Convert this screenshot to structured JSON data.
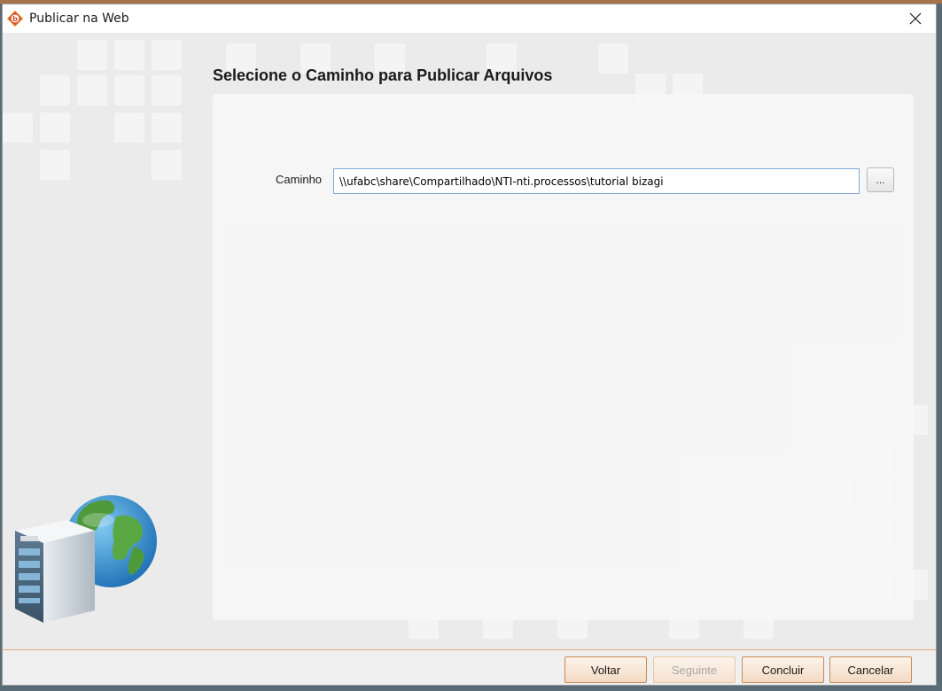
{
  "window": {
    "title": "Publicar na Web",
    "app_icon": "bizagi-logo-icon",
    "close_icon": "close-icon"
  },
  "page": {
    "heading": "Selecione o Caminho para Publicar Arquivos"
  },
  "form": {
    "path_label": "Caminho",
    "path_value": "\\\\ufabc\\share\\Compartilhado\\NTI-nti.processos\\tutorial bizagi",
    "browse_label": "..."
  },
  "footer": {
    "buttons": [
      {
        "label": "Voltar",
        "enabled": true
      },
      {
        "label": "Seguinte",
        "enabled": false
      },
      {
        "label": "Concluir",
        "enabled": true
      },
      {
        "label": "Cancelar",
        "enabled": true
      }
    ]
  },
  "illustration": {
    "icon": "server-globe-icon"
  },
  "colors": {
    "accent": "#e8a66e",
    "button_border": "#c98a55",
    "input_focus": "#7aa6d6"
  }
}
